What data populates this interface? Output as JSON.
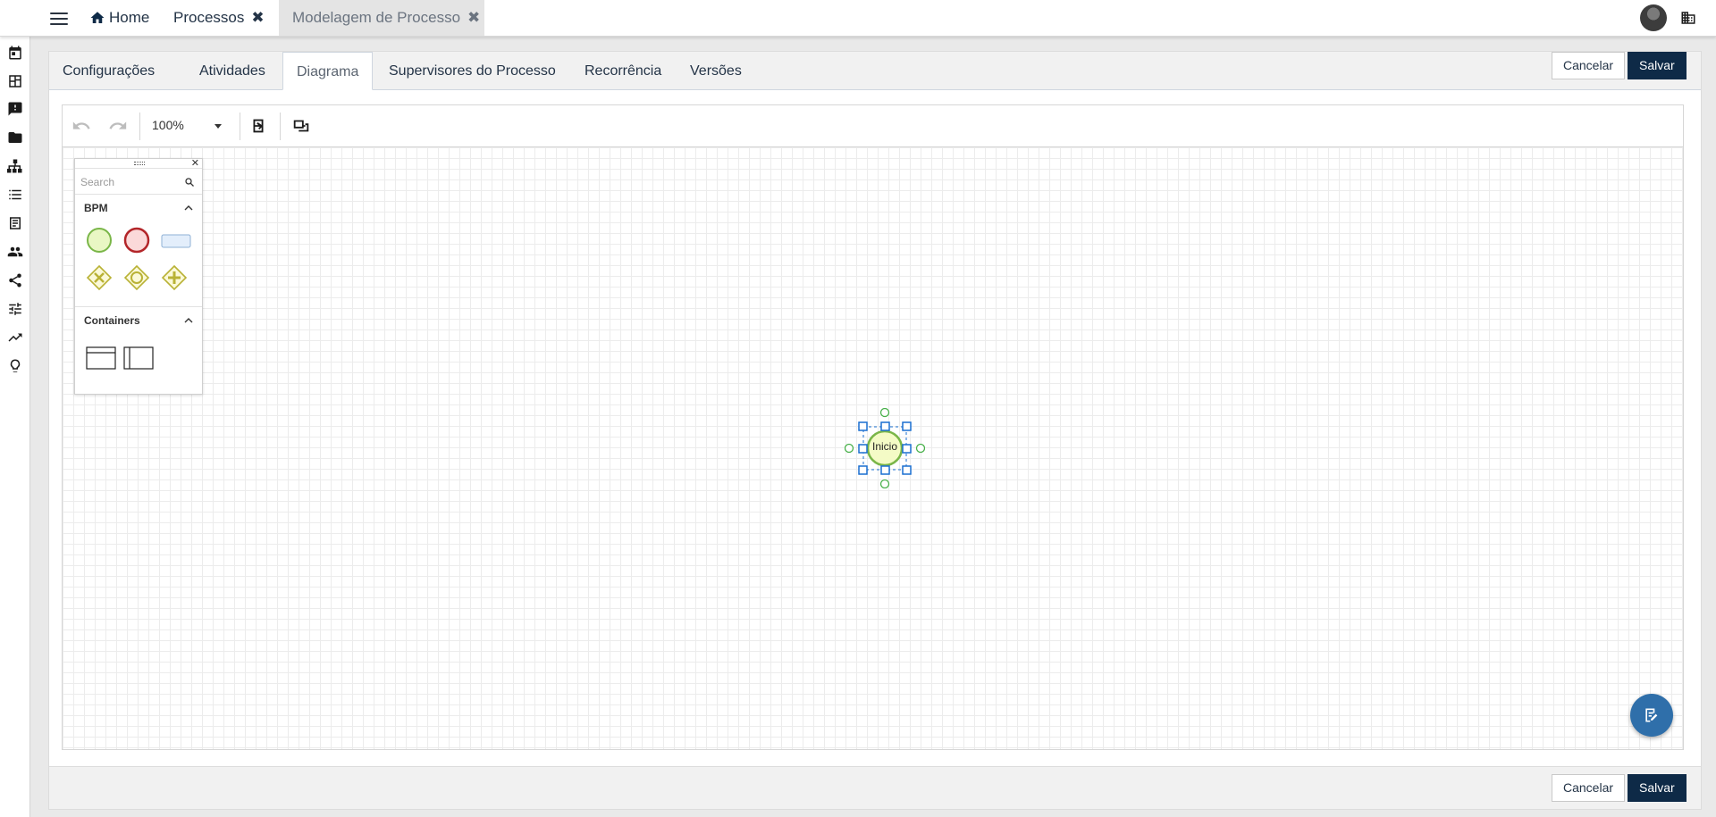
{
  "topbar": {
    "tabs": [
      {
        "label": "Home"
      },
      {
        "label": "Processos",
        "close": "✖"
      },
      {
        "label": "Modelagem de Processo",
        "close": "✖"
      }
    ]
  },
  "leftnav": {
    "icons": [
      "calendar-icon",
      "dashboard-icon",
      "feedback-icon",
      "folder-icon",
      "org-chart-icon",
      "list-icon",
      "document-icon",
      "people-icon",
      "share-icon",
      "sliders-icon",
      "trending-icon",
      "lightbulb-icon"
    ]
  },
  "tabs": [
    {
      "label": "Configurações"
    },
    {
      "label": "Atividades"
    },
    {
      "label": "Diagrama"
    },
    {
      "label": "Supervisores do Processo"
    },
    {
      "label": "Recorrência"
    },
    {
      "label": "Versões"
    }
  ],
  "active_tab": "Diagrama",
  "actions": {
    "cancel_label": "Cancelar",
    "save_label": "Salvar"
  },
  "editor": {
    "zoom": "100%",
    "palette": {
      "search_placeholder": "Search",
      "sections": [
        {
          "title": "BPM",
          "items": [
            "start-event",
            "end-event",
            "task",
            "exclusive-gateway",
            "inclusive-gateway",
            "parallel-gateway"
          ]
        },
        {
          "title": "Containers",
          "items": [
            "horizontal-pool",
            "vertical-pool"
          ]
        }
      ]
    },
    "nodes": [
      {
        "type": "start-event",
        "label": "Inicio",
        "selected": true
      }
    ]
  },
  "colors": {
    "primary": "#0e2a47",
    "fab": "#2f6faa",
    "start_fill": "#e9f7c4",
    "start_stroke": "#7ab648",
    "end_fill": "#fbd9d9",
    "end_stroke": "#b3262a",
    "gateway_stroke": "#b9b235",
    "selection": "#1a6fd1"
  }
}
